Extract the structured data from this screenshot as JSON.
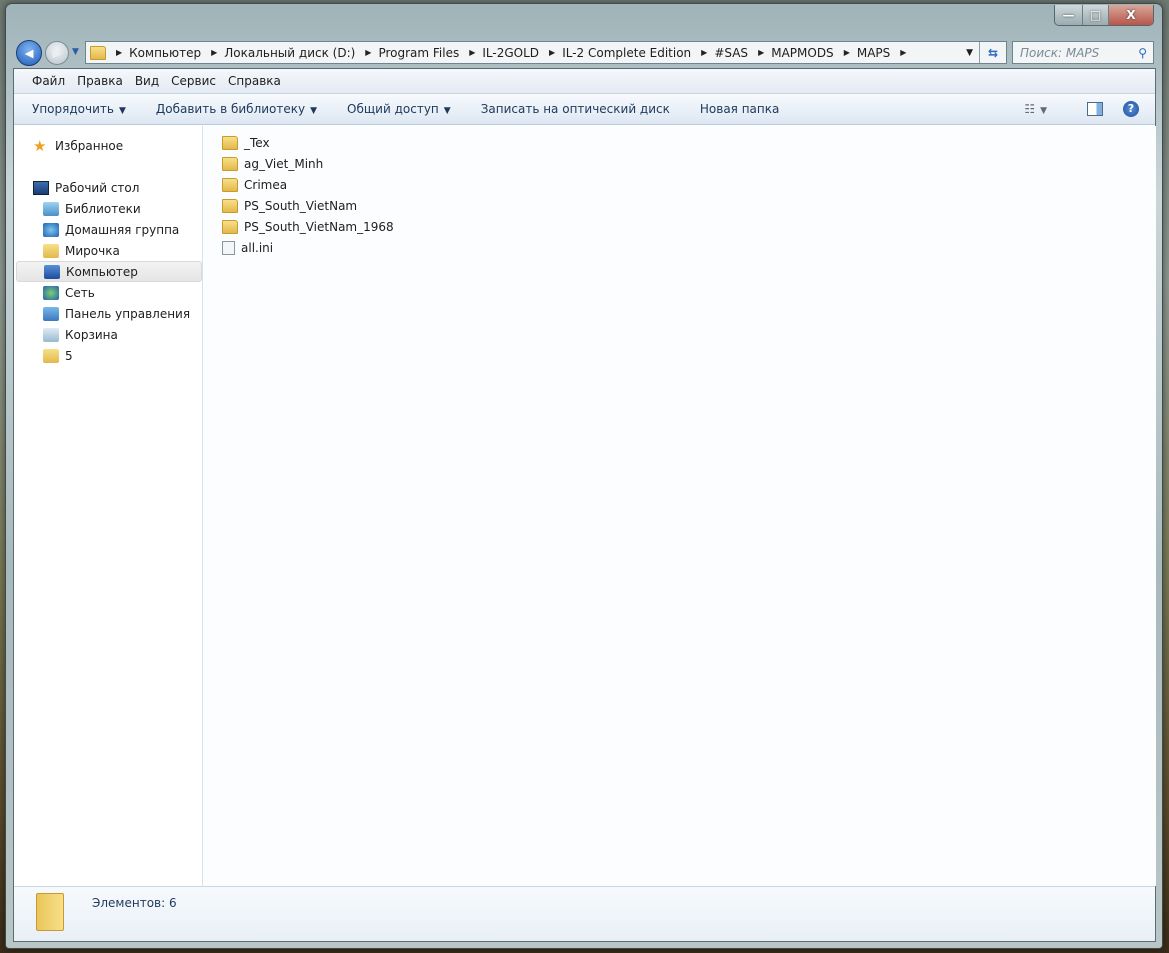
{
  "window": {
    "minimize": "—",
    "maximize": "□",
    "close": "X"
  },
  "address": {
    "crumbs": [
      "Компьютер",
      "Локальный диск (D:)",
      "Program Files",
      "IL-2GOLD",
      "IL-2 Complete Edition",
      "#SAS",
      "MAPMODS",
      "MAPS"
    ]
  },
  "search": {
    "placeholder": "Поиск: MAPS"
  },
  "menu": [
    "Файл",
    "Правка",
    "Вид",
    "Сервис",
    "Справка"
  ],
  "toolbar": {
    "organize": "Упорядочить",
    "add_library": "Добавить в библиотеку",
    "share": "Общий доступ",
    "burn": "Записать на оптический диск",
    "new_folder": "Новая папка"
  },
  "nav": {
    "favorites": "Избранное",
    "desktop": "Рабочий стол",
    "items": [
      "Библиотеки",
      "Домашняя группа",
      "Мирочка",
      "Компьютер",
      "Сеть",
      "Панель управления",
      "Корзина",
      "5"
    ],
    "selected": "Компьютер"
  },
  "files": [
    {
      "name": "_Tex",
      "type": "folder"
    },
    {
      "name": "ag_Viet_Minh",
      "type": "folder"
    },
    {
      "name": "Crimea",
      "type": "folder"
    },
    {
      "name": "PS_South_VietNam",
      "type": "folder"
    },
    {
      "name": "PS_South_VietNam_1968",
      "type": "folder"
    },
    {
      "name": "all.ini",
      "type": "ini-file"
    }
  ],
  "details": {
    "count": "Элементов: 6"
  }
}
